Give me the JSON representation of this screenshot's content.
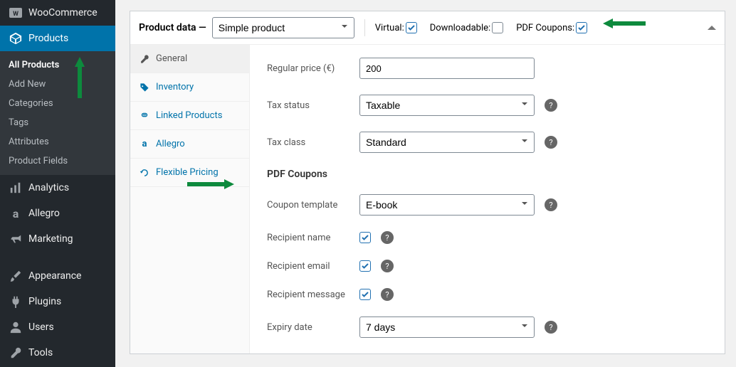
{
  "sidebar": {
    "top": {
      "label": "WooCommerce"
    },
    "active_section": {
      "label": "Products"
    },
    "sub_items": [
      {
        "label": "All Products",
        "current": true
      },
      {
        "label": "Add New"
      },
      {
        "label": "Categories"
      },
      {
        "label": "Tags"
      },
      {
        "label": "Attributes"
      },
      {
        "label": "Product Fields"
      }
    ],
    "items": [
      {
        "label": "Analytics",
        "name": "analytics",
        "icon": "chart"
      },
      {
        "label": "Allegro",
        "name": "allegro",
        "icon": "a"
      },
      {
        "label": "Marketing",
        "name": "marketing",
        "icon": "megaphone"
      },
      {
        "label": "Appearance",
        "name": "appearance",
        "icon": "brush"
      },
      {
        "label": "Plugins",
        "name": "plugins",
        "icon": "plug"
      },
      {
        "label": "Users",
        "name": "users",
        "icon": "user"
      },
      {
        "label": "Tools",
        "name": "tools",
        "icon": "wrench"
      }
    ]
  },
  "panel": {
    "title": "Product data —",
    "product_type": "Simple product",
    "checks": {
      "virtual_label": "Virtual:",
      "virtual_checked": true,
      "downloadable_label": "Downloadable:",
      "downloadable_checked": false,
      "pdf_label": "PDF Coupons:",
      "pdf_checked": true
    },
    "tabs": [
      {
        "label": "General",
        "name": "general",
        "icon": "wrench",
        "active": true
      },
      {
        "label": "Inventory",
        "name": "inventory",
        "icon": "tag"
      },
      {
        "label": "Linked Products",
        "name": "linked",
        "icon": "link"
      },
      {
        "label": "Allegro",
        "name": "allegro",
        "icon": "a"
      },
      {
        "label": "Flexible Pricing",
        "name": "pricing",
        "icon": "refresh"
      }
    ],
    "form": {
      "regular_price_label": "Regular price (€)",
      "regular_price_value": "200",
      "tax_status_label": "Tax status",
      "tax_status_value": "Taxable",
      "tax_class_label": "Tax class",
      "tax_class_value": "Standard",
      "section_heading": "PDF Coupons",
      "coupon_template_label": "Coupon template",
      "coupon_template_value": "E-book",
      "recipient_name_label": "Recipient name",
      "recipient_name_checked": true,
      "recipient_email_label": "Recipient email",
      "recipient_email_checked": true,
      "recipient_message_label": "Recipient message",
      "recipient_message_checked": true,
      "expiry_label": "Expiry date",
      "expiry_value": "7 days"
    }
  }
}
